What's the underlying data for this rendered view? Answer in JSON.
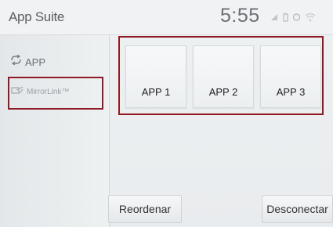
{
  "header": {
    "title": "App Suite",
    "time": "5:55",
    "status_icons": [
      "signal-icon",
      "battery-icon",
      "bluetooth-icon",
      "wifi-icon"
    ]
  },
  "sidebar": {
    "items": [
      {
        "label": "APP",
        "icon": "app-link-icon"
      },
      {
        "label": "MirrorLink™",
        "icon": "mirrorlink-icon"
      }
    ]
  },
  "main": {
    "tiles": [
      {
        "label": "APP 1"
      },
      {
        "label": "APP 2"
      },
      {
        "label": "APP 3"
      }
    ]
  },
  "footer": {
    "reorder_label": "Reordenar",
    "disconnect_label": "Desconectar"
  },
  "colors": {
    "highlight": "#8e1b24",
    "background": "#eef1f2"
  }
}
